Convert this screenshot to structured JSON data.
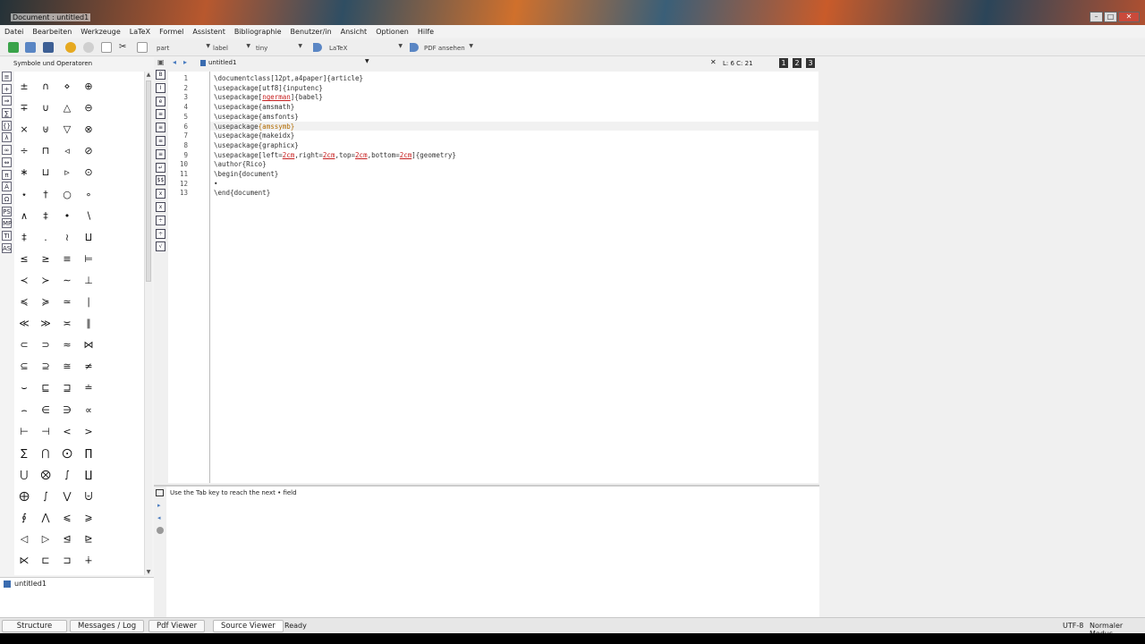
{
  "window": {
    "title": "Document : untitled1"
  },
  "menu": [
    "Datei",
    "Bearbeiten",
    "Werkzeuge",
    "LaTeX",
    "Formel",
    "Assistent",
    "Bibliographie",
    "Benutzer/in",
    "Ansicht",
    "Optionen",
    "Hilfe"
  ],
  "toolbar": {
    "combo_part": "part",
    "combo_label": "label",
    "combo_size": "tiny",
    "combo_latex": "LaTeX",
    "combo_pdf": "PDF ansehen"
  },
  "symbols_panel": {
    "title": "Symbole und Operatoren"
  },
  "symbols": [
    [
      "±",
      "∩",
      "⋄",
      "⊕"
    ],
    [
      "∓",
      "∪",
      "△",
      "⊖"
    ],
    [
      "×",
      "⊎",
      "▽",
      "⊗"
    ],
    [
      "÷",
      "⊓",
      "◃",
      "⊘"
    ],
    [
      "∗",
      "⊔",
      "▹",
      "⊙"
    ],
    [
      "⋆",
      "†",
      "○",
      "∘"
    ],
    [
      "∧",
      "‡",
      "•",
      "∖"
    ],
    [
      "‡",
      ".",
      "≀",
      "⨿"
    ],
    [
      "≤",
      "≥",
      "≡",
      "⊨"
    ],
    [
      "≺",
      "≻",
      "∼",
      "⊥"
    ],
    [
      "≼",
      "≽",
      "≃",
      "∣"
    ],
    [
      "≪",
      "≫",
      "≍",
      "∥"
    ],
    [
      "⊂",
      "⊃",
      "≈",
      "⋈"
    ],
    [
      "⊆",
      "⊇",
      "≅",
      "≠"
    ],
    [
      "⌣",
      "⊑",
      "⊒",
      "≐"
    ],
    [
      "⌢",
      "∈",
      "∋",
      "∝"
    ],
    [
      "⊢",
      "⊣",
      "<",
      ">"
    ],
    [
      "∑",
      "⋂",
      "⨀",
      "∏"
    ],
    [
      "⋃",
      "⨂",
      "∫",
      "∐"
    ],
    [
      "⨁",
      "∫",
      "⋁",
      "⨄"
    ],
    [
      "∮",
      "⋀",
      "⩽",
      "⩾"
    ],
    [
      "◁",
      "▷",
      "⊴",
      "⊵"
    ],
    [
      "⋉",
      "⊏",
      "⊐",
      "∔"
    ]
  ],
  "file_list": [
    "untitled1"
  ],
  "editor": {
    "tab_label": "untitled1",
    "cursor_pos": "L: 6 C: 21",
    "view_buttons": [
      "1",
      "2",
      "3"
    ],
    "line_numbers": [
      "1",
      "2",
      "3",
      "4",
      "5",
      "6",
      "7",
      "8",
      "9",
      "10",
      "11",
      "12",
      "13"
    ],
    "lines": [
      "\\documentclass[12pt,a4paper]{article}",
      "\\usepackage[utf8]{inputenc}",
      "\\usepackage[ngerman]{babel}",
      "\\usepackage{amsmath}",
      "\\usepackage{amsfonts}",
      "\\usepackage{amssymb}",
      "\\usepackage{makeidx}",
      "\\usepackage{graphicx}",
      "\\usepackage[left=2cm,right=2cm,top=2cm,bottom=2cm]{geometry}",
      "\\author{Rico}",
      "\\begin{document}",
      "•",
      "\\end{document}"
    ]
  },
  "messages": {
    "text": "Use the Tab key to reach the next • field"
  },
  "statusbar": {
    "tabs": [
      "Structure",
      "Messages / Log",
      "Pdf Viewer",
      "Source Viewer"
    ],
    "status": "Ready",
    "encoding": "UTF-8",
    "mode": "Normaler Modus"
  },
  "colors": {
    "accent": "#3a6cb0",
    "error_underline": "#c62020",
    "bracket_highlight": "#b06a00"
  }
}
